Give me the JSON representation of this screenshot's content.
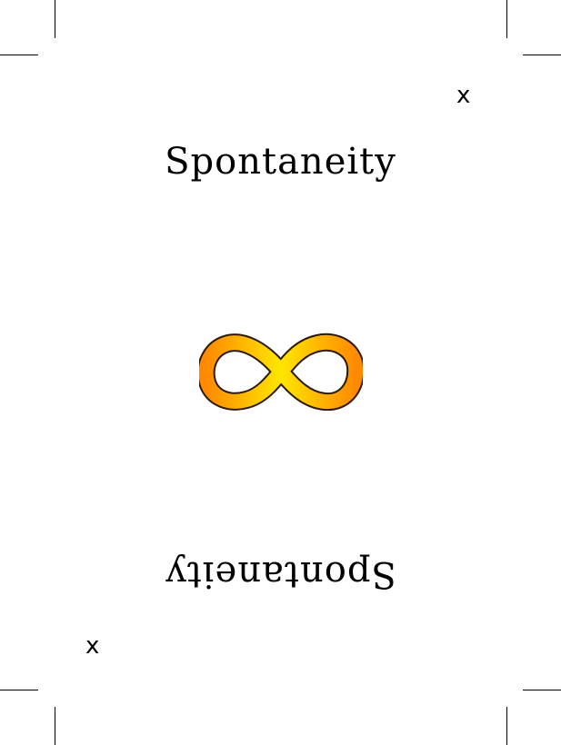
{
  "card": {
    "title_top": "Spontaneity",
    "title_bottom": "Spontaneity",
    "mark_top": "x",
    "mark_bottom": "x"
  },
  "symbol": {
    "icon": "infinity-icon",
    "gradient_colors": [
      "#ffe600",
      "#ff8a00"
    ],
    "outline_color": "#2b1a00"
  }
}
